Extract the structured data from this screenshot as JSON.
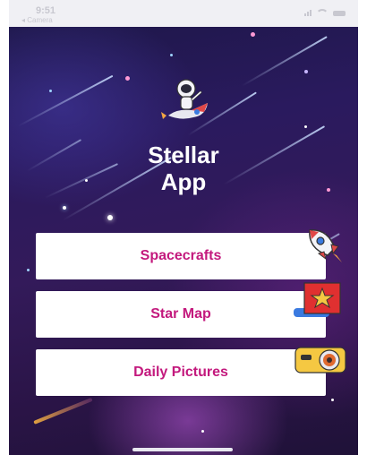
{
  "status_bar": {
    "time": "9:51",
    "back_label": "◂ Camera"
  },
  "app": {
    "title_line1": "Stellar",
    "title_line2": "App"
  },
  "menu": [
    {
      "label": "Spacecrafts",
      "icon": "rocket-icon"
    },
    {
      "label": "Star Map",
      "icon": "star-map-icon"
    },
    {
      "label": "Daily Pictures",
      "icon": "camera-icon"
    }
  ],
  "colors": {
    "accent_text": "#c3197d",
    "button_bg": "#ffffff",
    "background_dark": "#2a1a5e"
  }
}
